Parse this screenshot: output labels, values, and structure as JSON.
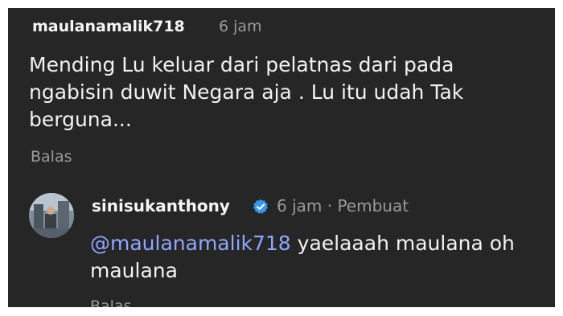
{
  "comment": {
    "username": "maulanamalik718",
    "time": "6 jam",
    "text": "Mending Lu keluar dari pelatnas dari pada ngabisin duwit Negara aja . Lu itu udah Tak berguna...",
    "reply_label": "Balas"
  },
  "reply": {
    "username": "sinisukanthony",
    "meta": "6 jam · Pembuat",
    "mention": "@maulanamalik718",
    "text": " yaelaaah maulana oh maulana",
    "reply_label": "Balas",
    "verified_icon": "verified-badge-icon"
  },
  "colors": {
    "background": "#262626",
    "mention": "#8fa6ff",
    "verified": "#3897f0",
    "secondary_text": "#9a9a9a"
  }
}
